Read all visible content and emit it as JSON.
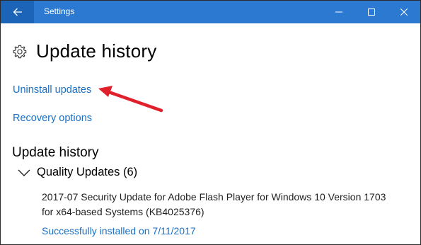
{
  "window": {
    "title": "Settings",
    "accent": "#2b79d0",
    "back_icon": "back-arrow-icon",
    "controls": [
      "minimize-icon",
      "maximize-icon",
      "close-icon"
    ]
  },
  "page": {
    "title": "Update history",
    "icon": "gear-icon"
  },
  "links": {
    "uninstall": "Uninstall updates",
    "recovery": "Recovery options",
    "link_color": "#1a6fc4"
  },
  "history": {
    "section_title": "Update history",
    "groups": [
      {
        "label": "Quality Updates (6)",
        "expanded": true,
        "items": [
          {
            "title_line1": "2017-07 Security Update for Adobe Flash Player for Windows 10 Version 1703",
            "title_line2": "for x64-based Systems (KB4025376)",
            "status": "Successfully installed on 7/11/2017"
          }
        ]
      }
    ]
  },
  "annotation": {
    "type": "red-arrow",
    "color": "#e0202b",
    "points_to": "Uninstall updates"
  }
}
